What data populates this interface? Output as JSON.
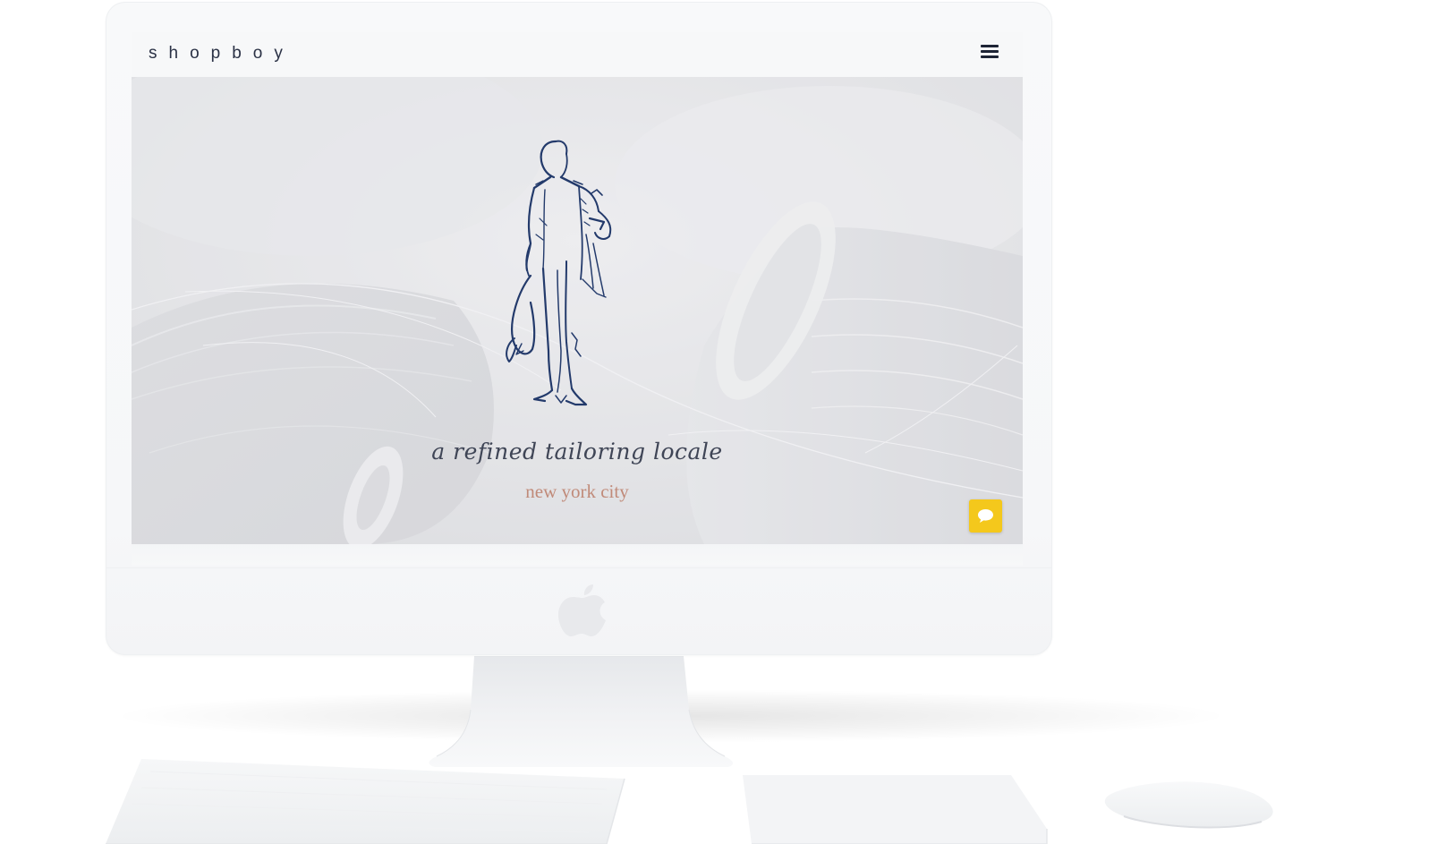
{
  "site": {
    "brand": "shopboy",
    "menu_icon": "hamburger-menu-icon",
    "hero": {
      "tagline": "a refined tailoring locale",
      "location": "new york city",
      "figure_icon": "tailor-sketch-figure",
      "chat_icon": "chat-bubble-icon"
    }
  },
  "device": {
    "type": "desktop monitor mockup",
    "logo_icon": "apple-logo-icon"
  },
  "colors": {
    "brand_text": "#2a3145",
    "figure_ink": "#233a6b",
    "tagline": "#3f4556",
    "location": "#c08a79",
    "chat_button": "#f4c81c",
    "hero_background": "#e1e2e5"
  }
}
